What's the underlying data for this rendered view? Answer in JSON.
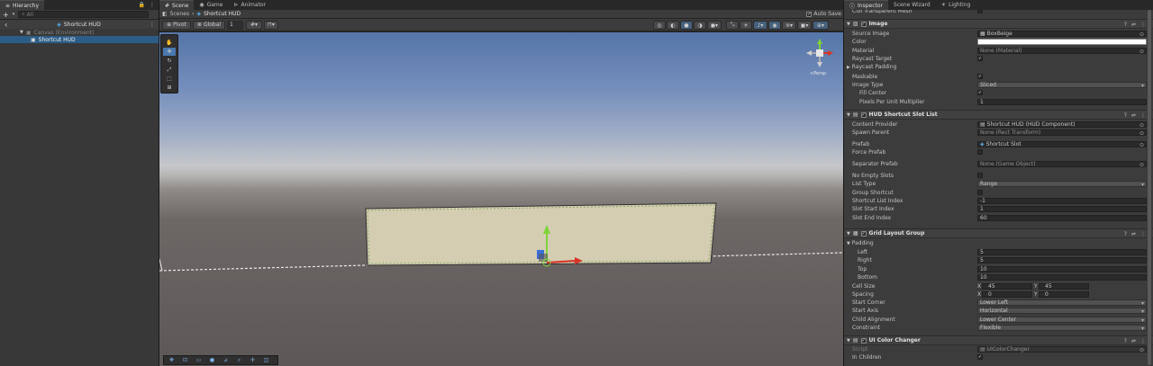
{
  "hierarchy": {
    "tab": "Hierarchy",
    "add": "+",
    "search_placeholder": "All",
    "scene": "Shortcut HUD",
    "items": [
      {
        "label": "Canvas (Environment)",
        "dim": true
      },
      {
        "label": "Shortcut HUD",
        "dim": false
      }
    ]
  },
  "scene_tabs": [
    {
      "label": "Scene",
      "active": true
    },
    {
      "label": "Game",
      "active": false
    },
    {
      "label": "Animator",
      "active": false
    }
  ],
  "scene": {
    "breadcrumb_root": "Scenes",
    "breadcrumb_current": "Shortcut HUD",
    "auto_save": "Auto Save",
    "pivot": "Pivot",
    "global": "Global",
    "snap": "1",
    "persp": "<Persp"
  },
  "inspector_tabs": [
    {
      "label": "Inspector",
      "active": true
    },
    {
      "label": "Scene Wizard",
      "active": false
    },
    {
      "label": "Lighting",
      "active": false
    }
  ],
  "inspector": {
    "top_label": "Cull Transparent Mesh",
    "image": {
      "title": "Image",
      "rows": [
        {
          "label": "Source Image",
          "value": "BoxBeige"
        },
        {
          "label": "Color",
          "value": ""
        },
        {
          "label": "Material",
          "value": "None (Material)"
        },
        {
          "label": "Raycast Target",
          "value": "✓"
        },
        {
          "label": "Raycast Padding",
          "value": ""
        },
        {
          "label": "Maskable",
          "value": "✓"
        },
        {
          "label": "Image Type",
          "value": "Sliced"
        },
        {
          "label": "Fill Center",
          "value": "✓"
        },
        {
          "label": "Pixels Per Unit Multiplier",
          "value": "1"
        }
      ]
    },
    "slotlist": {
      "title": "HUD Shortcut Slot List",
      "rows": [
        {
          "label": "Content Provider",
          "value": "Shortcut HUD (HUD Component)"
        },
        {
          "label": "Spawn Parent",
          "value": "None (Rect Transform)"
        },
        {
          "label": "Prefab",
          "value": "Shortcut Slot"
        },
        {
          "label": "Force Prefab",
          "value": ""
        },
        {
          "label": "Separator Prefab",
          "value": "None (Game Object)"
        },
        {
          "label": "No Empty Slots",
          "value": ""
        },
        {
          "label": "List Type",
          "value": "Range"
        },
        {
          "label": "Group Shortcut",
          "value": ""
        },
        {
          "label": "Shortcut List Index",
          "value": "-1"
        },
        {
          "label": "Slot Start Index",
          "value": "1"
        },
        {
          "label": "Slot End Index",
          "value": "60"
        }
      ]
    },
    "grid": {
      "title": "Grid Layout Group",
      "padding_label": "Padding",
      "padding": [
        {
          "label": "Left",
          "value": "5"
        },
        {
          "label": "Right",
          "value": "5"
        },
        {
          "label": "Top",
          "value": "10"
        },
        {
          "label": "Bottom",
          "value": "10"
        }
      ],
      "cell_size": {
        "label": "Cell Size",
        "x": "45",
        "y": "45"
      },
      "spacing": {
        "label": "Spacing",
        "x": "0",
        "y": "0"
      },
      "rows": [
        {
          "label": "Start Corner",
          "value": "Lower Left"
        },
        {
          "label": "Start Axis",
          "value": "Horizontal"
        },
        {
          "label": "Child Alignment",
          "value": "Lower Center"
        },
        {
          "label": "Constraint",
          "value": "Flexible"
        }
      ]
    },
    "colorchanger": {
      "title": "UI Color Changer",
      "rows": [
        {
          "label": "Script",
          "value": "UIColorChanger"
        },
        {
          "label": "In Children",
          "value": "✓"
        }
      ]
    }
  },
  "colors": {
    "selection": "#2c5d87",
    "panel": "#383838",
    "field": "#2a2a2a",
    "hud_fill": "#d4cdb2",
    "gizmo_y": "#7fd43a",
    "gizmo_x": "#d8352a",
    "gizmo_z": "#3b6fd8"
  }
}
